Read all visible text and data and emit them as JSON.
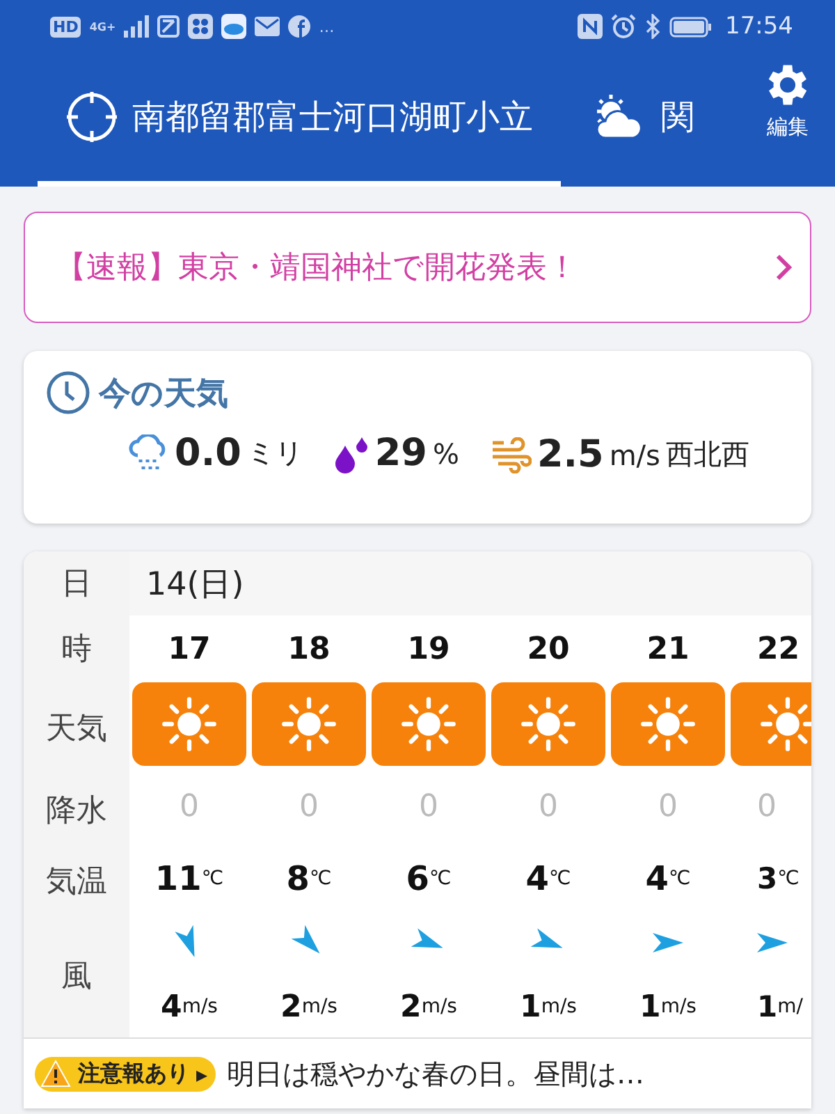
{
  "status_bar": {
    "left_badges": [
      "HD",
      "4G+"
    ],
    "more": "…",
    "time": "17:54"
  },
  "tabs": [
    {
      "label": "南都留郡富士河口湖町小立",
      "kind": "location",
      "selected": true
    },
    {
      "label": "関",
      "kind": "weather",
      "selected": false
    }
  ],
  "edit_button": {
    "label": "編集"
  },
  "news_banner": {
    "text": "【速報】東京・靖国神社で開花発表！"
  },
  "current": {
    "title": "今の天気",
    "rain": {
      "value": "0.0",
      "unit": "ミリ"
    },
    "humidity": {
      "value": "29",
      "unit": "%"
    },
    "wind": {
      "value": "2.5",
      "unit": "m/s",
      "direction": "西北西"
    }
  },
  "forecast": {
    "labels": {
      "day": "日",
      "hour": "時",
      "weather": "天気",
      "precip": "降水",
      "temp": "気温",
      "wind": "風"
    },
    "date": "14(日)",
    "hours": [
      {
        "hour": "17",
        "kind": "sunny",
        "precip": "0",
        "temp": "11",
        "temp_unit": "℃",
        "wind_arrow": {
          "kind": "nnw"
        },
        "wind": "4",
        "wind_unit": "m/s"
      },
      {
        "hour": "18",
        "kind": "sunny",
        "precip": "0",
        "temp": "8",
        "temp_unit": "℃",
        "wind_arrow": {
          "kind": "nw"
        },
        "wind": "2",
        "wind_unit": "m/s"
      },
      {
        "hour": "19",
        "kind": "sunny",
        "precip": "0",
        "temp": "6",
        "temp_unit": "℃",
        "wind_arrow": {
          "kind": "wnw"
        },
        "wind": "2",
        "wind_unit": "m/s"
      },
      {
        "hour": "20",
        "kind": "sunny",
        "precip": "0",
        "temp": "4",
        "temp_unit": "℃",
        "wind_arrow": {
          "kind": "wnw"
        },
        "wind": "1",
        "wind_unit": "m/s"
      },
      {
        "hour": "21",
        "kind": "sunny",
        "precip": "0",
        "temp": "4",
        "temp_unit": "℃",
        "wind_arrow": {
          "kind": "w"
        },
        "wind": "1",
        "wind_unit": "m/s"
      },
      {
        "hour": "22",
        "kind": "sunny",
        "precip": "0",
        "temp": "3",
        "temp_unit": "℃",
        "wind_arrow": {
          "kind": "w"
        },
        "wind": "1",
        "wind_unit": "m/"
      }
    ]
  },
  "notice": {
    "badge": "注意報あり",
    "badge_arrow": "▸",
    "text": "明日は穏やかな春の日。昼間は…"
  }
}
